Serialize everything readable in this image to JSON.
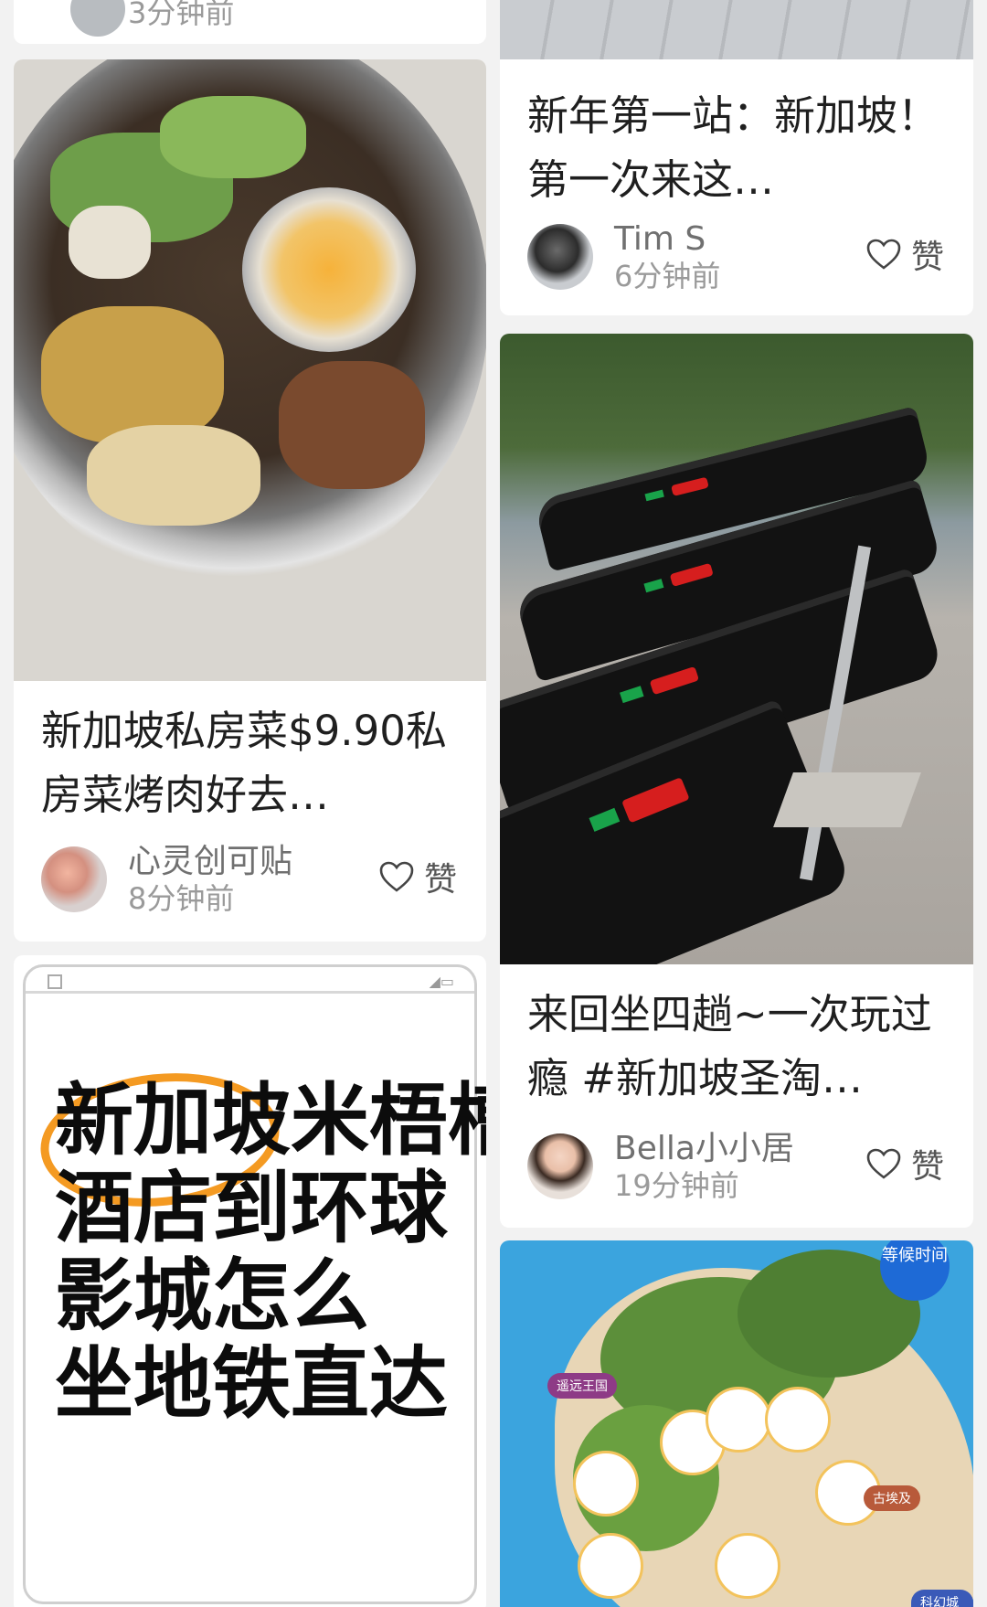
{
  "feed": {
    "left": [
      {
        "id_label": "top-cut-card",
        "time": "3分钟前"
      },
      {
        "title": "新加坡私房菜$9.90私房菜烤肉好去…",
        "author": "心灵创可贴",
        "time": "8分钟前",
        "like_label": "赞"
      },
      {
        "poster_lines": [
          "新加坡米梧槽",
          "酒店到环球",
          "影城怎么",
          "坐地铁直达"
        ]
      }
    ],
    "right": [
      {
        "title": "新年第一站：新加坡！ 第一次来这…",
        "author": "Tim S",
        "time": "6分钟前",
        "like_label": "赞"
      },
      {
        "title": "来回坐四趟~一次玩过瘾 #新加坡圣淘…",
        "author": "Bella小小居",
        "time": "19分钟前",
        "like_label": "赞"
      },
      {
        "map_badge": "等候时间",
        "map_labels": [
          "遥远王国",
          "古埃及",
          "科幻城市"
        ]
      }
    ]
  },
  "colors": {
    "background": "#f2f2f2",
    "card": "#ffffff",
    "accent_orange": "#f49a22",
    "map_blue": "#3ba4de"
  }
}
